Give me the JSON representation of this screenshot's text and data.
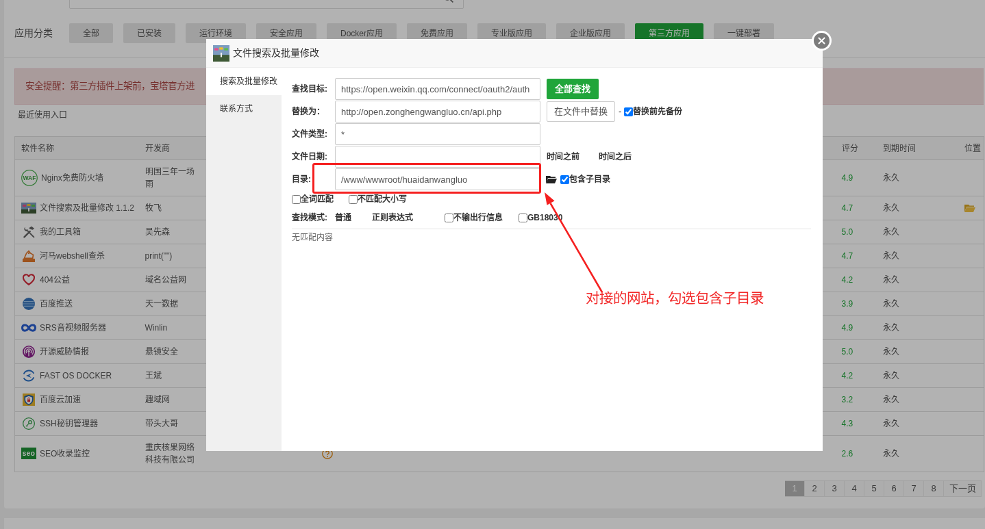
{
  "categories": {
    "label": "应用分类",
    "items": [
      {
        "label": "全部",
        "selected": false
      },
      {
        "label": "已安装",
        "selected": false
      },
      {
        "label": "运行环境",
        "selected": false
      },
      {
        "label": "安全应用",
        "selected": false
      },
      {
        "label": "Docker应用",
        "selected": false
      },
      {
        "label": "免费应用",
        "selected": false
      },
      {
        "label": "专业版应用",
        "selected": false
      },
      {
        "label": "企业版应用",
        "selected": false
      },
      {
        "label": "第三方应用",
        "selected": true
      },
      {
        "label": "一键部署",
        "selected": false
      }
    ]
  },
  "alert": {
    "text": "安全提醒：第三方插件上架前，宝塔官方进"
  },
  "recent": {
    "label": "最近使用入口"
  },
  "table": {
    "header": {
      "name": "软件名称",
      "developer": "开发商",
      "score": "评分",
      "expiry": "到期时间",
      "location": "位置"
    },
    "rows": [
      {
        "logo": {
          "kind": "ring",
          "text": "WAF"
        },
        "name": "Nginx免费防火墙",
        "developer": "明国三年一场雨",
        "score": "4.9",
        "expiry": "永久",
        "folder": false
      },
      {
        "name": "文件搜索及批量修改 1.1.2",
        "developer": "牧飞",
        "score": "4.7",
        "expiry": "永久",
        "folder": true
      },
      {
        "name": "我的工具箱",
        "developer": "吴先森",
        "score": "5.0",
        "expiry": "永久",
        "folder": false
      },
      {
        "name": "河马webshell查杀",
        "developer": "print(\"\")",
        "score": "4.7",
        "expiry": "永久",
        "folder": false
      },
      {
        "name": "404公益",
        "developer": "域名公益网",
        "score": "4.2",
        "expiry": "永久",
        "folder": false
      },
      {
        "name": "百度推送",
        "developer": "天一数据",
        "score": "3.9",
        "expiry": "永久",
        "folder": false
      },
      {
        "name": "SRS音视频服务器",
        "developer": "Winlin",
        "score": "4.9",
        "expiry": "永久",
        "folder": false
      },
      {
        "name": "开源威胁情报",
        "developer": "悬镜安全",
        "score": "5.0",
        "expiry": "永久",
        "folder": false
      },
      {
        "name": "FAST OS DOCKER",
        "developer": "王斌",
        "score": "4.2",
        "expiry": "永久",
        "folder": false
      },
      {
        "name": "百度云加速",
        "developer": "趣域网",
        "score": "3.2",
        "expiry": "永久",
        "folder": false
      },
      {
        "name": "SSH秘钥管理器",
        "developer": "带头大哥",
        "score": "4.3",
        "expiry": "永久",
        "folder": false
      },
      {
        "logo": {
          "kind": "tile",
          "text": "seo"
        },
        "name": "SEO收录监控",
        "developer": "重庆核果网络科技有限公司",
        "score": "2.6",
        "expiry": "永久",
        "folder": false
      }
    ]
  },
  "pagination": {
    "pages": [
      {
        "label": "1",
        "selected": true
      },
      {
        "label": "2",
        "selected": false
      },
      {
        "label": "3",
        "selected": false
      },
      {
        "label": "4",
        "selected": false
      },
      {
        "label": "5",
        "selected": false
      },
      {
        "label": "6",
        "selected": false
      },
      {
        "label": "7",
        "selected": false
      },
      {
        "label": "8",
        "selected": false
      }
    ],
    "next": "下一页"
  },
  "dialog": {
    "title": "文件搜索及批量修改",
    "tabs": [
      {
        "label": "搜索及批量修改",
        "selected": true
      },
      {
        "label": "联系方式",
        "selected": false
      }
    ],
    "find": {
      "label": "查找目标:",
      "value": "https://open.weixin.qq.com/connect/oauth2/auth",
      "button": "全部查找"
    },
    "replace": {
      "label": "替换为：",
      "value": "http://open.zonghengwangluo.cn/api.php",
      "button": "在文件中替换",
      "separator": "-",
      "backup": {
        "label": "替换前先备份",
        "checked": true
      }
    },
    "file_type": {
      "label": "文件类型:",
      "value": "*"
    },
    "file_date": {
      "label": "文件日期:",
      "before": "时间之前",
      "after": "时间之后"
    },
    "directory": {
      "label": "目录:",
      "value": "/www/wwwroot/huaidanwangluo",
      "subdirs": {
        "label": "包含子目录",
        "checked": true
      }
    },
    "options": [
      {
        "label": "全词匹配",
        "checked": false
      },
      {
        "label": "不匹配大小写",
        "checked": false
      }
    ],
    "mode": {
      "label": "查找模式:",
      "choices": [
        "普通",
        "正则表达式"
      ],
      "flags": [
        {
          "label": "不输出行信息",
          "checked": false
        },
        {
          "label": "GB18030",
          "checked": false
        }
      ]
    },
    "result": "无匹配内容"
  },
  "annotation": {
    "note": "对接的网站，勾选包含子目录"
  }
}
